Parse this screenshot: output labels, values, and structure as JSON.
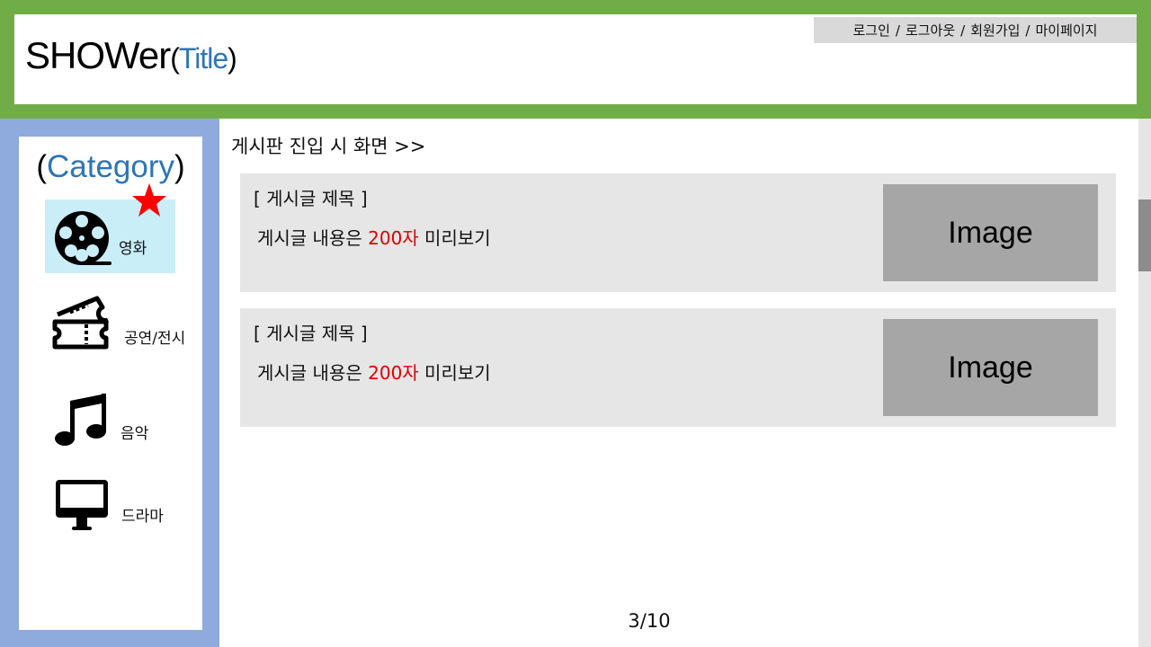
{
  "header": {
    "title": "SHOWer",
    "title_paren_open": "(",
    "title_sub": "Title",
    "title_paren_close": ")",
    "auth_links": [
      "로그인",
      "로그아웃",
      "회원가입",
      "마이페이지"
    ],
    "separator": "/"
  },
  "sidebar": {
    "title_paren_open": "(",
    "title": "Category",
    "title_paren_close": ")",
    "items": [
      {
        "label": "영화",
        "icon": "film-reel-icon",
        "active": true,
        "starred": true
      },
      {
        "label": "공연/전시",
        "icon": "ticket-icon",
        "active": false
      },
      {
        "label": "음악",
        "icon": "music-note-icon",
        "active": false
      },
      {
        "label": "드라마",
        "icon": "monitor-icon",
        "active": false
      }
    ]
  },
  "main": {
    "heading": "게시판 진입 시 화면 >>",
    "posts": [
      {
        "title": "[ 게시글 제목 ]",
        "preview_before": "게시글 내용은 ",
        "preview_highlight": "200자",
        "preview_after": " 미리보기",
        "image_label": "Image"
      },
      {
        "title": "[ 게시글 제목 ]",
        "preview_before": "게시글 내용은 ",
        "preview_highlight": "200자",
        "preview_after": " 미리보기",
        "image_label": "Image"
      }
    ],
    "page_indicator": "3/10"
  },
  "colors": {
    "header_band": "#70ad47",
    "sidebar_band": "#8faadc",
    "accent_blue": "#2e75b6",
    "highlight_red": "#e00000",
    "active_category": "#c9eef8",
    "star": "#ff0000"
  }
}
